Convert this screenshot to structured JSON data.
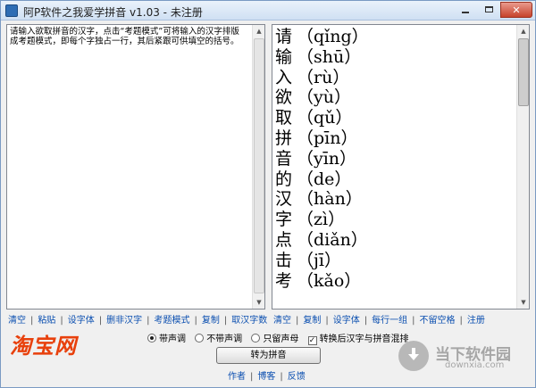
{
  "window": {
    "title": "阿P软件之我爱学拼音 v1.03 - 未注册"
  },
  "left_pane": {
    "text": "请输入欲取拼音的汉字，点击“考题模式”可将输入的汉字排版成考题模式，即每个字独占一行，其后紧跟可供填空的括号。"
  },
  "right_pane": {
    "lines": [
      {
        "hanzi": "请",
        "pinyin": "（qǐng）"
      },
      {
        "hanzi": "输",
        "pinyin": "（shū）"
      },
      {
        "hanzi": "入",
        "pinyin": "（rù）"
      },
      {
        "hanzi": "欲",
        "pinyin": "（yù）"
      },
      {
        "hanzi": "取",
        "pinyin": "（qǔ）"
      },
      {
        "hanzi": "拼",
        "pinyin": "（pīn）"
      },
      {
        "hanzi": "音",
        "pinyin": "（yīn）"
      },
      {
        "hanzi": "的",
        "pinyin": "（de）"
      },
      {
        "hanzi": "汉",
        "pinyin": "（hàn）"
      },
      {
        "hanzi": "字",
        "pinyin": "（zì）"
      },
      {
        "hanzi": "点",
        "pinyin": "（diǎn）"
      },
      {
        "hanzi": "击",
        "pinyin": "（jī）"
      },
      {
        "hanzi": "考",
        "pinyin": "（kǎo）"
      }
    ]
  },
  "left_links": [
    "清空",
    "粘贴",
    "设字体",
    "删非汉字",
    "考题模式",
    "复制",
    "取汉字数"
  ],
  "right_links": [
    "清空",
    "复制",
    "设字体",
    "每行一组",
    "不留空格",
    "注册"
  ],
  "logo": "淘宝网",
  "options": {
    "tone_on": "带声调",
    "tone_off": "不带声调",
    "initials_only": "只留声母",
    "mix_label": "转换后汉字与拼音混排",
    "selected_radio": "tone_on",
    "mix_checked": true
  },
  "convert_button": "转为拼音",
  "bottom_links": [
    "作者",
    "博客",
    "反馈"
  ],
  "watermark": {
    "cn": "当下软件园",
    "en": "downxia.com"
  },
  "colors": {
    "link": "#0b4fb0",
    "logo": "#e8400c",
    "close_button": "#c7432c"
  }
}
